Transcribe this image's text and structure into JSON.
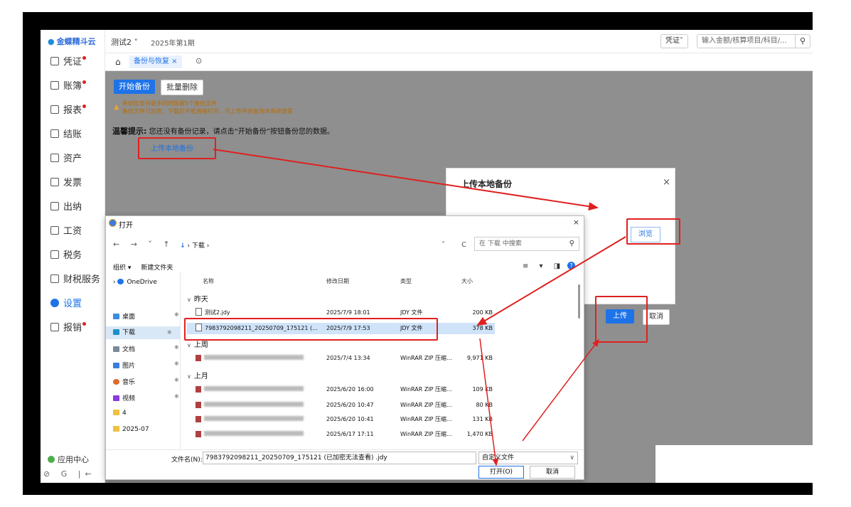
{
  "app": {
    "logo": "金蝶精斗云",
    "account": "测试2 ˅",
    "period": "2025年第1期",
    "voucher_btn": "凭证˅",
    "search_placeholder": "输入金额/核算项目/科目/...",
    "search_icon": "search-icon"
  },
  "sidebar": {
    "items": [
      {
        "label": "凭证",
        "badge": true
      },
      {
        "label": "账簿",
        "badge": true
      },
      {
        "label": "报表",
        "badge": true
      },
      {
        "label": "结账",
        "badge": false
      },
      {
        "label": "资产",
        "badge": false
      },
      {
        "label": "发票",
        "badge": false
      },
      {
        "label": "出纳",
        "badge": false
      },
      {
        "label": "工资",
        "badge": false
      },
      {
        "label": "税务",
        "badge": false
      },
      {
        "label": "财税服务",
        "badge": false
      },
      {
        "label": "设置",
        "badge": false
      },
      {
        "label": "报销",
        "badge": true
      }
    ],
    "footer": "应用中心",
    "tools": "⊘ G |←"
  },
  "tabs": {
    "home_icon": "home-icon",
    "active": "备份与恢复 ×",
    "menu": "⊙"
  },
  "content": {
    "start_backup": "开始备份",
    "batch_delete": "批量删除",
    "notice_line1": "系统仅支持最多同时保留5个备份文件",
    "notice_line2": "备份文件已加密，下载后不能直接打开，可上传并恢复到本系统查看",
    "tip_label": "温馨提示:",
    "tip_text": "您还没有备份记录，请点击“开始备份”按钮备份您的数据。",
    "upload_local": "上传本地备份"
  },
  "upload_dialog": {
    "title": "上传本地备份",
    "close": "×",
    "browse": "浏览",
    "upload": "上传",
    "cancel": "取消"
  },
  "file_dialog": {
    "title": "打开",
    "close": "×",
    "nav": "← → ˅ ↑",
    "path_icon": "↓",
    "path": "› 下载 ›",
    "path_controls": "˅ C",
    "search_placeholder": "在 下载 中搜索",
    "organize": "组织 ▾",
    "new_folder": "新建文件夹",
    "view_controls": "≡ ▾ ◨",
    "help": "?",
    "sidebar": [
      {
        "label": "OneDrive",
        "color": "#1e73e8"
      },
      {
        "label": "桌面",
        "color": "#3a8ee0"
      },
      {
        "label": "下载",
        "color": "#1e90c8"
      },
      {
        "label": "文档",
        "color": "#7a8a9a"
      },
      {
        "label": "图片",
        "color": "#3a7de0"
      },
      {
        "label": "音乐",
        "color": "#e06a2a"
      },
      {
        "label": "视频",
        "color": "#8a3ae0"
      },
      {
        "label": "4",
        "color": "#f0c040"
      },
      {
        "label": "2025-07",
        "color": "#f0c040"
      }
    ],
    "pin": "✱",
    "columns": {
      "name": "名称",
      "date": "修改日期",
      "type": "类型",
      "size": "大小"
    },
    "groups": [
      "昨天",
      "上周",
      "上月"
    ],
    "files_yesterday": [
      {
        "name": "测试2.jdy",
        "date": "2025/7/9 18:01",
        "type": "JDY 文件",
        "size": "200 KB"
      },
      {
        "name": "7983792098211_20250709_175121 (...",
        "date": "2025/7/9 17:53",
        "type": "JDY 文件",
        "size": "378 KB"
      }
    ],
    "files_lastweek": [
      {
        "date": "2025/7/4 13:34",
        "type": "WinRAR ZIP 压缩...",
        "size": "9,971 KB"
      }
    ],
    "files_lastmonth": [
      {
        "date": "2025/6/20 16:00",
        "type": "WinRAR ZIP 压缩...",
        "size": "109 KB"
      },
      {
        "date": "2025/6/20 10:47",
        "type": "WinRAR ZIP 压缩...",
        "size": "80 KB"
      },
      {
        "date": "2025/6/20 10:41",
        "type": "WinRAR ZIP 压缩...",
        "size": "131 KB"
      },
      {
        "date": "2025/6/17 17:11",
        "type": "WinRAR ZIP 压缩...",
        "size": "1,470 KB"
      }
    ],
    "filename_label": "文件名(N):",
    "filename_value": "7983792098211_20250709_175121 (已加密无法查看) .jdy",
    "filetype": "自定义文件",
    "open": "打开(O)",
    "cancel": "取消"
  },
  "colors": {
    "accent": "#1e73e8",
    "highlight": "#e02020",
    "overlay": "#8f8f8f"
  }
}
